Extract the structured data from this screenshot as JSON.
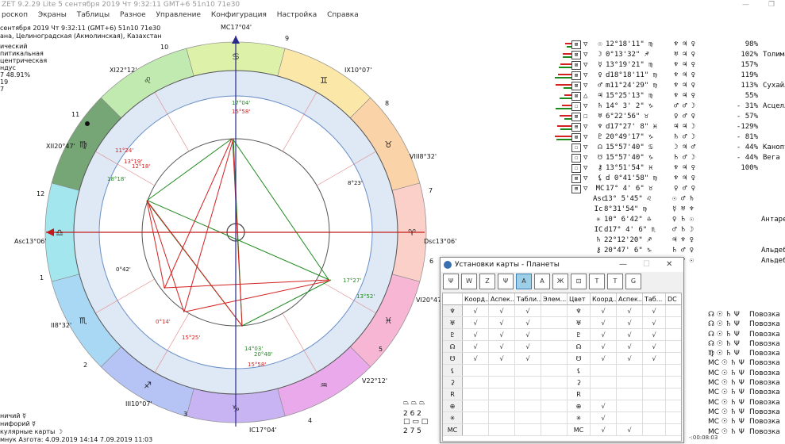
{
  "window": {
    "title": "ZET 9.2.29 Lite   5 сентября 2019  Чт   9:32:11 GMT+6 51n10  71e30",
    "controls": [
      "—",
      "❐"
    ]
  },
  "menu": [
    "роскоп",
    "Экраны",
    "Таблицы",
    "Разное",
    "Управление",
    "Конфигурация",
    "Настройка",
    "Справка"
  ],
  "info": {
    "line1": "сентября 2019   Чт   9:32:11 (GMT+6) 51n10  71e30",
    "line2": "ана, Целиноградская (Акмолинская), Казахстан",
    "line3": "ический",
    "line4": "питикальная",
    "line5": "центрическая",
    "line6": "ндус",
    "line7": "7 48.91%",
    "line8": "19",
    "line9": "7"
  },
  "chart": {
    "houses": [
      "1",
      "2",
      "3",
      "4",
      "5",
      "6",
      "7",
      "8",
      "9",
      "10",
      "11",
      "12"
    ],
    "cusps": {
      "mc": "MC17°04'",
      "ic": "IC17°04'",
      "asc": "Asc13°06'",
      "dsc": "Dsc13°06'",
      "ii": "II8°32'",
      "iii": "III10°07'",
      "v": "V22°12'",
      "vi": "VI20°47'",
      "viii": "VIII8°32'",
      "ix": "IX10°07'",
      "xi": "XI22°12'",
      "xii": "XII20°47'"
    },
    "planet_labels": {
      "mc_inner": "17°04'",
      "sun_top": "15°58'",
      "mercury": "11°24'",
      "sun": "13°19'",
      "moon_top": "12°18'",
      "venus": "18°18'",
      "node_r": "8°23'",
      "jupiter_r": "0°42'",
      "neptune": "17°27'",
      "saturn": "13°52'",
      "moon": "0°14'",
      "mars": "15°25'",
      "pluto": "14°03'",
      "uranus": "20°48'",
      "sun_bottom": "15°58'"
    },
    "colors": {
      "red": "#d42020",
      "green": "#1d8a1d",
      "ring_inner": "#dfe8f5"
    }
  },
  "positions": {
    "rows": [
      {
        "box": "⊠",
        "tri": "▽",
        "sym": "☉",
        "pos": "12°18'11\" ♍",
        "asp": "♆  ♃  ♀",
        "pct": "98%",
        "star": ""
      },
      {
        "box": "⊠",
        "tri": "▽",
        "sym": "☽",
        "pos": "0°13'32\" ♐",
        "asp": "♅  ♃  ♀",
        "pct": "102%",
        "star": "Толиман"
      },
      {
        "box": "⊠",
        "tri": "▽",
        "sym": "☿",
        "pos": "13°19'21\" ♍",
        "asp": "♆  ♃  ♀",
        "pct": "157%",
        "star": ""
      },
      {
        "box": "⊠",
        "tri": "▽",
        "sym": "♀",
        "pos": "d18°18'11\" ♍",
        "asp": "♆  ♃  ♀",
        "pct": "119%",
        "star": ""
      },
      {
        "box": "⊠",
        "tri": "▽",
        "sym": "♂",
        "pos": "m11°24'29\" ♍",
        "asp": "♆  ♃  ♀",
        "pct": "113%",
        "star": "Сухайль"
      },
      {
        "box": "⊠",
        "tri": "△",
        "sym": "♃",
        "pos": "15°25'13\" ♍",
        "asp": "♆  ♃  ♀",
        "pct": "55%",
        "star": ""
      },
      {
        "box": "☐",
        "tri": "▽",
        "sym": "♄",
        "pos": "14° 3' 2\" ♑",
        "asp": "♂  ♂  ☽",
        "pct": "- 31%",
        "star": "Асцелла"
      },
      {
        "box": "⊠",
        "tri": "☐",
        "sym": "♅",
        "pos": "6°22'56\" ♉",
        "asp": "♀  ♂  ♀",
        "pct": "- 57%",
        "star": ""
      },
      {
        "box": "⊞",
        "tri": "▽",
        "sym": "♆",
        "pos": "d17°27' 8\" ♓",
        "asp": "♃  ♃  ☽",
        "pct": "-129%",
        "star": ""
      },
      {
        "box": "⊠",
        "tri": "▽",
        "sym": "♇",
        "pos": "20°49'17\" ♑",
        "asp": "♄  ♂  ☽",
        "pct": "- 81%",
        "star": ""
      },
      {
        "box": "☐",
        "tri": "▽",
        "sym": "☊",
        "pos": "15°57'40\" ♋",
        "asp": "☽  ♃  ♂",
        "pct": "- 44%",
        "star": "Канопус"
      },
      {
        "box": "☐",
        "tri": "▽",
        "sym": "☋",
        "pos": "15°57'40\" ♑",
        "asp": "♄  ♂  ☽",
        "pct": "- 44%",
        "star": "Вега"
      },
      {
        "box": "☐",
        "tri": "▽",
        "sym": "⚷",
        "pos": "13°51'54\" ♓",
        "asp": "♆  ♃  ♀",
        "pct": "100%",
        "star": ""
      },
      {
        "box": "⊠",
        "tri": "▽",
        "sym": "⚸",
        "pos": "d 0°41'58\" ♍",
        "asp": "♆  ♃  ♀",
        "pct": "",
        "star": ""
      },
      {
        "box": "⊞",
        "tri": "▽",
        "sym": "MC",
        "pos": "17° 4' 6\" ♉",
        "asp": "♀  ♂  ♀",
        "pct": "",
        "star": ""
      },
      {
        "box": "",
        "tri": "",
        "sym": "Asc",
        "pos": "13° 5'45\" ♌",
        "asp": "☉  ♂  ♄",
        "pct": "",
        "star": ""
      },
      {
        "box": "",
        "tri": "",
        "sym": "Ic",
        "pos": "8°31'54\" ♍",
        "asp": "☿  ♅  ♆",
        "pct": "",
        "star": ""
      },
      {
        "box": "",
        "tri": "",
        "sym": "✳",
        "pos": "10° 6'42\" ♎",
        "asp": "♀  ♄  ☉",
        "pct": "",
        "star": "Антарес"
      },
      {
        "box": "",
        "tri": "",
        "sym": "IC",
        "pos": "d17° 4' 6\" ♏",
        "asp": "♂  ♄  ☽",
        "pct": "",
        "star": ""
      },
      {
        "box": "",
        "tri": "",
        "sym": "♄",
        "pos": "22°12'20\" ♐",
        "asp": "♃  ♆  ♀",
        "pct": "",
        "star": ""
      },
      {
        "box": "",
        "tri": "",
        "sym": "⚷",
        "pos": "20°47' 6\" ♑",
        "asp": "♄  ♂  ♀",
        "pct": "",
        "star": "Альдебаран"
      },
      {
        "box": "",
        "tri": "",
        "sym": "Dsc",
        "pos": "13° 5'45\" ♒",
        "asp": "♄  ♆  ☉",
        "pct": "",
        "star": "Альдебаран"
      }
    ]
  },
  "dialog": {
    "title": "Установки карты - Планеты",
    "toolbar": [
      "Ψ",
      "W",
      "Z",
      "Ψ",
      "A",
      "A",
      "Ж",
      "⊡",
      "T",
      "T",
      "G"
    ],
    "columns": [
      "",
      "Коорд...",
      "Аспек...",
      "Табли...",
      "Элем...",
      "Цвет",
      "Коорд...",
      "Аспек...",
      "Таб...",
      "DC",
      "МР"
    ],
    "rows": [
      {
        "sym": "♆",
        "c": [
          "√",
          "√",
          "√",
          "",
          "♆",
          "√",
          "√",
          "√",
          "",
          ""
        ]
      },
      {
        "sym": "♅",
        "c": [
          "√",
          "√",
          "√",
          "",
          "♅",
          "√",
          "√",
          "√",
          "",
          ""
        ]
      },
      {
        "sym": "♇",
        "c": [
          "√",
          "√",
          "√",
          "",
          "♇",
          "√",
          "√",
          "√",
          "",
          ""
        ]
      },
      {
        "sym": "☊",
        "c": [
          "√",
          "√",
          "√",
          "",
          "☊",
          "√",
          "√",
          "√",
          "",
          ""
        ]
      },
      {
        "sym": "☋",
        "c": [
          "√",
          "√",
          "√",
          "",
          "☋",
          "√",
          "√",
          "√",
          "",
          ""
        ]
      },
      {
        "sym": "⚸",
        "c": [
          "",
          "",
          "",
          "",
          "⚸",
          "",
          "",
          "",
          "",
          ""
        ]
      },
      {
        "sym": "⚳",
        "c": [
          "",
          "",
          "",
          "",
          "⚳",
          "",
          "",
          "",
          "",
          ""
        ]
      },
      {
        "sym": "R",
        "c": [
          "",
          "",
          "",
          "",
          "R",
          "",
          "",
          "",
          "",
          ""
        ]
      },
      {
        "sym": "⊕",
        "c": [
          "",
          "",
          "",
          "",
          "⊕",
          "√",
          "",
          "",
          "",
          ""
        ]
      },
      {
        "sym": "✳",
        "c": [
          "",
          "",
          "",
          "",
          "✳",
          "√",
          "",
          "",
          "",
          ""
        ]
      },
      {
        "sym": "MC",
        "c": [
          "",
          "",
          "",
          "",
          "MC",
          "√",
          "√",
          "",
          "",
          ""
        ]
      }
    ],
    "status": "-:00:08:03"
  },
  "povozka": {
    "label": "Повозка",
    "rows": [
      "☊ ☉ ♄ Ψ",
      "☊ ☉ ♄ Ψ",
      "☊ ☉ ♄ Ψ",
      "☊ ☉ ♄ Ψ",
      "♍ ☉ ♄ Ψ",
      "MC ☉ ♄ Ψ",
      "MC ☉ ♄ Ψ",
      "MC ☉ ♄ Ψ",
      "MC ☉ ♄ Ψ",
      "MC ☉ ♄ Ψ",
      "MC ☉ ♄ Ψ",
      "MC ☉ ♄ Ψ",
      "MC ☉ ♄ Ψ"
    ]
  },
  "bottom": {
    "line1": "ничий   ☿",
    "line2": "нифорий   ☿",
    "line3": "кулярные карты   ☽",
    "line4": "мнук Азгота: 4.09.2019 14:14  7.09.2019 11:03",
    "icons_row1": "2  6  2",
    "icons_row2": "2  7  5"
  }
}
